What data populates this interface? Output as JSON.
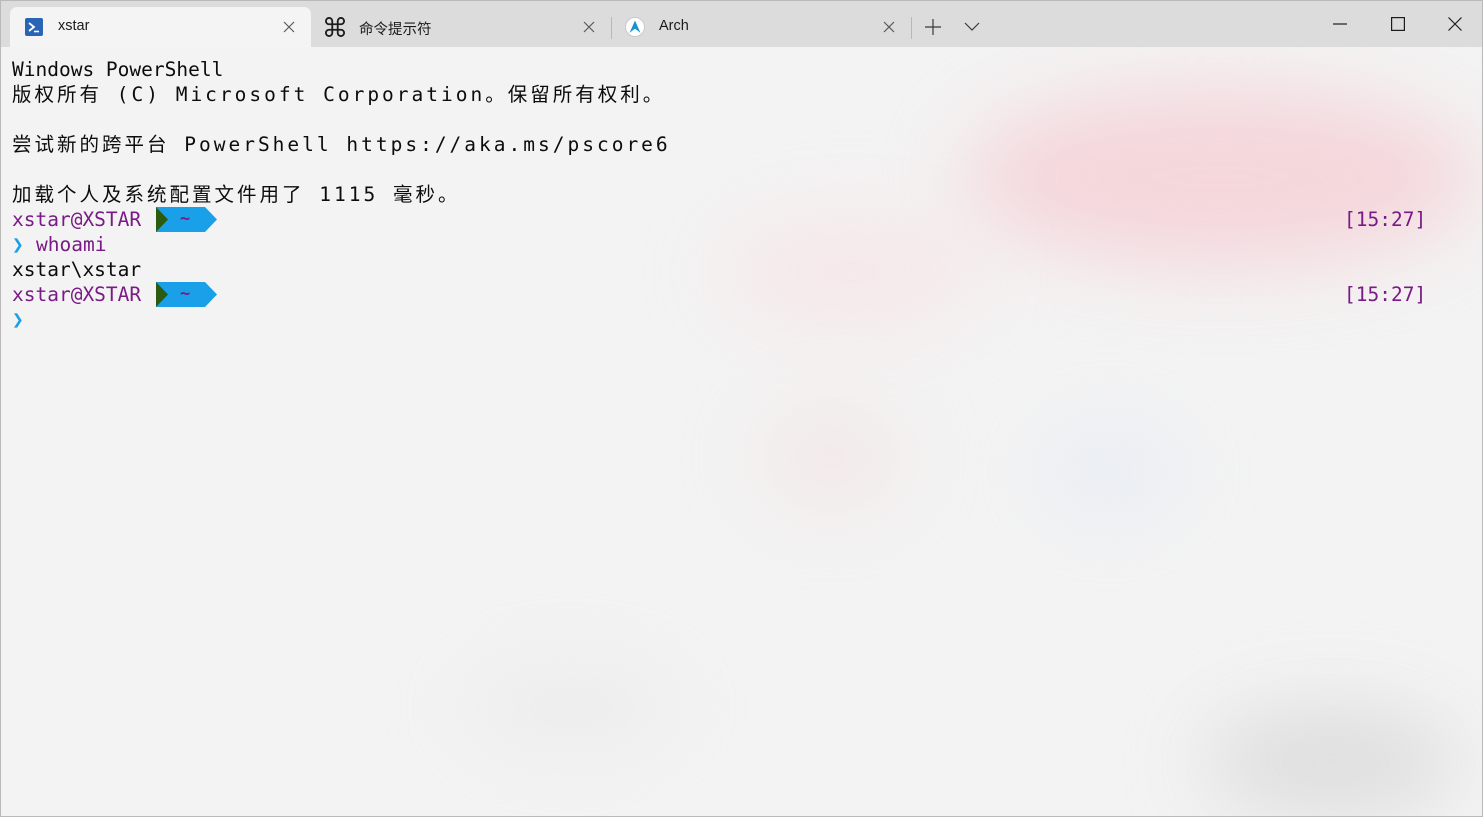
{
  "tabs": [
    {
      "label": "xstar",
      "icon": "powershell-icon",
      "active": true
    },
    {
      "label": "命令提示符",
      "icon": "command-key-icon",
      "active": false
    },
    {
      "label": "Arch",
      "icon": "arch-linux-icon",
      "active": false
    }
  ],
  "toolbar": {
    "new_tab_icon": "plus-icon",
    "dropdown_icon": "chevron-down-icon"
  },
  "window_controls": {
    "minimize_icon": "minimize-icon",
    "maximize_icon": "maximize-icon",
    "close_icon": "close-icon"
  },
  "terminal": {
    "lines": [
      "Windows PowerShell",
      "版权所有 (C) Microsoft Corporation。保留所有权利。",
      "",
      "尝试新的跨平台 PowerShell https://aka.ms/pscore6",
      "",
      "加载个人及系统配置文件用了 1115 毫秒。"
    ],
    "prompts": [
      {
        "user_host": "xstar@XSTAR",
        "path": "~",
        "time": "[15:27]",
        "symbol": "❯",
        "command": "whoami",
        "output": "xstar\\xstar"
      },
      {
        "user_host": "xstar@XSTAR",
        "path": "~",
        "time": "[15:27]",
        "symbol": "❯",
        "command": ""
      }
    ]
  },
  "colors": {
    "prompt_user": "#7a1a86",
    "prompt_symbol": "#1aa0e8",
    "segment_dark": "#2c5a0e",
    "segment_blue": "#1aa0e8",
    "tab_bar": "#dcdcdc",
    "background": "#f3f3f3"
  }
}
